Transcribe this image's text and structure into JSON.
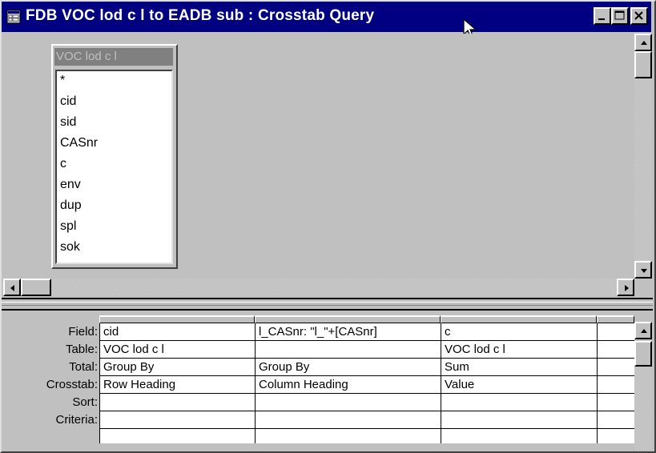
{
  "window": {
    "title": "FDB VOC lod c l to EADB sub : Crosstab Query",
    "title_icon": "query-icon",
    "controls": [
      "minimize-icon",
      "maximize-icon",
      "close-icon"
    ]
  },
  "colors": {
    "titlebar": "#000080",
    "face": "#c0c0c0",
    "table_title": "#808080"
  },
  "table_box": {
    "title": "VOC lod c l",
    "fields": [
      "*",
      "cid",
      "sid",
      "CASnr",
      "c",
      "env",
      "dup",
      "spl",
      "sok"
    ]
  },
  "grid": {
    "row_labels": [
      "Field:",
      "Table:",
      "Total:",
      "Crosstab:",
      "Sort:",
      "Criteria:"
    ],
    "columns": [
      {
        "field": "cid",
        "table": "VOC lod c l",
        "total": "Group By",
        "crosstab": "Row Heading",
        "sort": "",
        "criteria": ""
      },
      {
        "field": "l_CASnr: \"l_\"+[CASnr]",
        "table": "",
        "total": "Group By",
        "crosstab": "Column Heading",
        "sort": "",
        "criteria": ""
      },
      {
        "field": "c",
        "table": "VOC lod c l",
        "total": "Sum",
        "crosstab": "Value",
        "sort": "",
        "criteria": ""
      }
    ]
  }
}
